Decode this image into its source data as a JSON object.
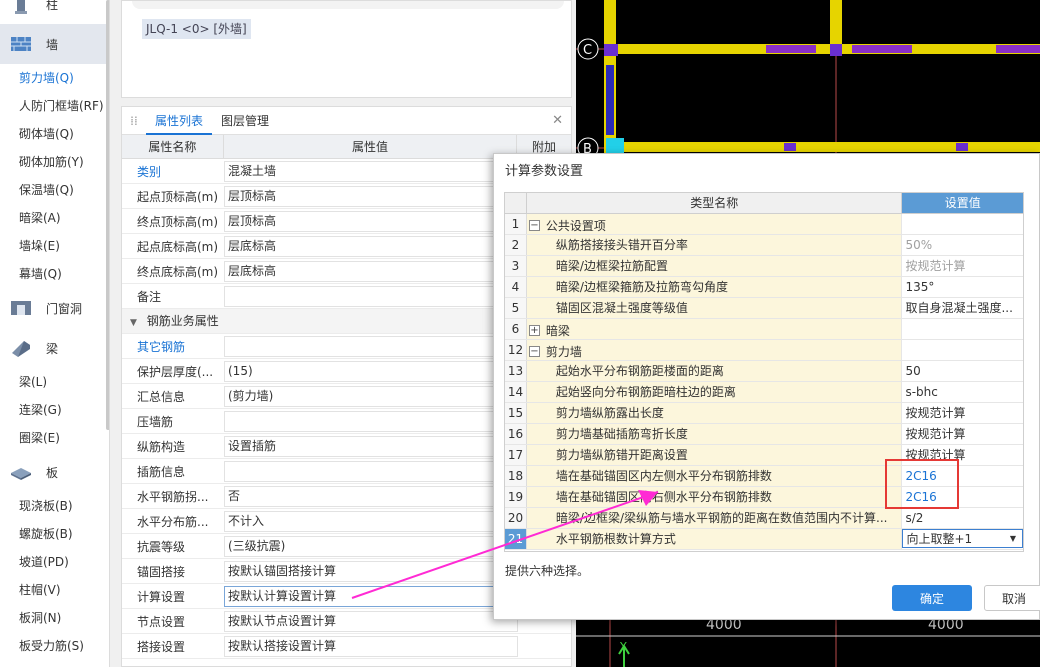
{
  "left_nav": {
    "top_cat": "柱",
    "wall_cat": "墙",
    "wall_items": [
      "剪力墙(Q)",
      "人防门框墙(RF)",
      "砌体墙(Q)",
      "砌体加筋(Y)",
      "保温墙(Q)",
      "暗梁(A)",
      "墙垛(E)",
      "幕墙(Q)"
    ],
    "door_cat": "门窗洞",
    "beam_cat": "梁",
    "beam_items": [
      "梁(L)",
      "连梁(G)",
      "圈梁(E)"
    ],
    "slab_cat": "板",
    "slab_items": [
      "现浇板(B)",
      "螺旋板(B)",
      "坡道(PD)",
      "柱帽(V)",
      "板洞(N)",
      "板受力筋(S)"
    ]
  },
  "preview": {
    "tag": "JLQ-1 <0> [外墙]"
  },
  "prop_panel": {
    "tab_properties": "属性列表",
    "tab_layers": "图层管理",
    "col_name": "属性名称",
    "col_value": "属性值",
    "col_extra": "附加",
    "rows": [
      {
        "name": "类别",
        "value": "混凝土墙",
        "blue": true
      },
      {
        "name": "起点顶标高(m)",
        "value": "层顶标高"
      },
      {
        "name": "终点顶标高(m)",
        "value": "层顶标高"
      },
      {
        "name": "起点底标高(m)",
        "value": "层底标高"
      },
      {
        "name": "终点底标高(m)",
        "value": "层底标高"
      },
      {
        "name": "备注",
        "value": ""
      }
    ],
    "section_rebar": "钢筋业务属性",
    "rebar_rows": [
      {
        "name": "其它钢筋",
        "value": "",
        "blue": true
      },
      {
        "name": "保护层厚度(...",
        "value": "(15)"
      },
      {
        "name": "汇总信息",
        "value": "(剪力墙)"
      },
      {
        "name": "压墙筋",
        "value": ""
      },
      {
        "name": "纵筋构造",
        "value": "设置插筋"
      },
      {
        "name": "插筋信息",
        "value": ""
      },
      {
        "name": "水平钢筋拐...",
        "value": "否"
      },
      {
        "name": "水平分布筋...",
        "value": "不计入"
      },
      {
        "name": "抗震等级",
        "value": "(三级抗震)"
      },
      {
        "name": "锚固搭接",
        "value": "按默认锚固搭接计算"
      },
      {
        "name": "计算设置",
        "value": "按默认计算设置计算",
        "selected": true
      },
      {
        "name": "节点设置",
        "value": "按默认节点设置计算"
      },
      {
        "name": "搭接设置",
        "value": "按默认搭接设置计算"
      }
    ]
  },
  "cad": {
    "axis_c": "C",
    "axis_b": "B",
    "dim_left": "4000",
    "dim_right": "4000",
    "axis_y": "Y"
  },
  "dialog": {
    "title": "计算参数设置",
    "col_type": "类型名称",
    "col_value": "设置值",
    "rows": [
      {
        "no": "1",
        "name": "公共设置项",
        "group": true,
        "sign": "−",
        "value": ""
      },
      {
        "no": "2",
        "name": "纵筋搭接接头错开百分率",
        "value": "50%",
        "gray": true
      },
      {
        "no": "3",
        "name": "暗梁/边框梁拉筋配置",
        "value": "按规范计算",
        "gray": true
      },
      {
        "no": "4",
        "name": "暗梁/边框梁箍筋及拉筋弯勾角度",
        "value": "135°"
      },
      {
        "no": "5",
        "name": "锚固区混凝土强度等级值",
        "value": "取自身混凝土强度..."
      },
      {
        "no": "6",
        "name": "暗梁",
        "group": true,
        "sign": "+",
        "value": ""
      },
      {
        "no": "12",
        "name": "剪力墙",
        "group": true,
        "sign": "−",
        "value": ""
      },
      {
        "no": "13",
        "name": "起始水平分布钢筋距楼面的距离",
        "value": "50"
      },
      {
        "no": "14",
        "name": "起始竖向分布钢筋距暗柱边的距离",
        "value": "s-bhc"
      },
      {
        "no": "15",
        "name": "剪力墙纵筋露出长度",
        "value": "按规范计算"
      },
      {
        "no": "16",
        "name": "剪力墙基础插筋弯折长度",
        "value": "按规范计算"
      },
      {
        "no": "17",
        "name": "剪力墙纵筋错开距离设置",
        "value": "按规范计算"
      },
      {
        "no": "18",
        "name": "墙在基础锚固区内左侧水平分布钢筋排数",
        "value": "2C16",
        "blue": true
      },
      {
        "no": "19",
        "name": "墙在基础锚固区内右侧水平分布钢筋排数",
        "value": "2C16",
        "blue": true
      },
      {
        "no": "20",
        "name": "暗梁/边框梁/梁纵筋与墙水平钢筋的距离在数值范围内不计算...",
        "value": "s/2"
      },
      {
        "no": "21",
        "name": "水平钢筋根数计算方式",
        "value": "向上取整+1",
        "active": true,
        "dropdown": true
      }
    ],
    "hint": "提供六种选择。",
    "ok_label": "确定",
    "cancel_label": "取消"
  }
}
